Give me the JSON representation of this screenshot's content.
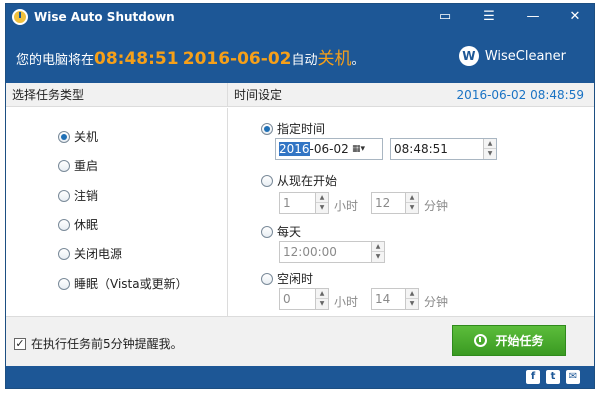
{
  "window": {
    "title": "Wise Auto Shutdown",
    "controls": {
      "menu_glyph": "▭",
      "list_glyph": "☰",
      "min_glyph": "—",
      "close_glyph": "✕"
    }
  },
  "header": {
    "prefix": "您的电脑将在",
    "time": "08:48:51",
    "date": "2016-06-02",
    "middle": "自动",
    "action": "关机",
    "suffix": "。",
    "brand_logo": "W",
    "brand_name": "WiseCleaner"
  },
  "left": {
    "heading": "选择任务类型",
    "options": [
      {
        "label": "关机",
        "selected": true
      },
      {
        "label": "重启",
        "selected": false
      },
      {
        "label": "注销",
        "selected": false
      },
      {
        "label": "休眠",
        "selected": false
      },
      {
        "label": "关闭电源",
        "selected": false
      },
      {
        "label": "睡眠（Vista或更新）",
        "selected": false
      }
    ]
  },
  "right": {
    "heading": "时间设定",
    "current_datetime": "2016-06-02 08:48:59",
    "specified": {
      "label": "指定时间",
      "date_year": "2016",
      "date_rest": "-06-02",
      "time": "08:48:51"
    },
    "from_now": {
      "label": "从现在开始",
      "hours": "1",
      "hours_unit": "小时",
      "minutes": "12",
      "minutes_unit": "分钟"
    },
    "daily": {
      "label": "每天",
      "time": "12:00:00"
    },
    "idle": {
      "label": "空闲时",
      "hours": "0",
      "hours_unit": "小时",
      "minutes": "14",
      "minutes_unit": "分钟"
    }
  },
  "footer": {
    "remind_label": "在执行任务前5分钟提醒我。",
    "remind_checked": true,
    "start_label": "开始任务"
  },
  "social": [
    "f",
    "t",
    "✉"
  ],
  "colors": {
    "primary": "#1d5796",
    "accent": "#f6a019",
    "start_button": "#3fa428",
    "link": "#1a73c4"
  }
}
